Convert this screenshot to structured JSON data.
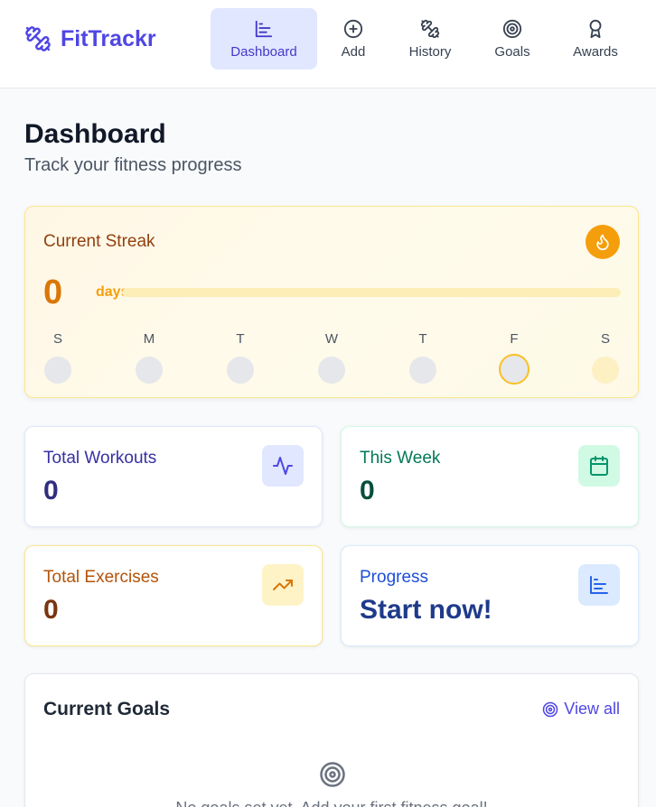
{
  "app": {
    "name": "FitTrackr",
    "accent": "#4f46e5"
  },
  "nav": {
    "items": [
      {
        "label": "Dashboard",
        "icon": "bar-chart-icon",
        "active": true
      },
      {
        "label": "Add",
        "icon": "plus-circle-icon",
        "active": false
      },
      {
        "label": "History",
        "icon": "dumbbell-icon",
        "active": false
      },
      {
        "label": "Goals",
        "icon": "target-icon",
        "active": false
      },
      {
        "label": "Awards",
        "icon": "award-icon",
        "active": false
      }
    ]
  },
  "page": {
    "title": "Dashboard",
    "subtitle": "Track your fitness progress"
  },
  "streak": {
    "title": "Current Streak",
    "count": "0",
    "unit": "days",
    "progress": 0,
    "icon": "flame-icon",
    "days": [
      {
        "label": "S",
        "state": "past"
      },
      {
        "label": "M",
        "state": "past"
      },
      {
        "label": "T",
        "state": "past"
      },
      {
        "label": "W",
        "state": "past"
      },
      {
        "label": "T",
        "state": "past"
      },
      {
        "label": "F",
        "state": "today"
      },
      {
        "label": "S",
        "state": "future"
      }
    ]
  },
  "stats": {
    "total_workouts": {
      "label": "Total Workouts",
      "value": "0",
      "icon": "activity-icon",
      "color": "#4f46e5"
    },
    "this_week": {
      "label": "This Week",
      "value": "0",
      "icon": "calendar-icon",
      "color": "#059669"
    },
    "total_exercises": {
      "label": "Total Exercises",
      "value": "0",
      "icon": "trending-up-icon",
      "color": "#d97706"
    },
    "progress": {
      "label": "Progress",
      "value": "Start now!",
      "icon": "bar-chart-icon",
      "color": "#2563eb"
    }
  },
  "goals": {
    "title": "Current Goals",
    "view_all": "View all",
    "empty_text": "No goals set yet. Add your first fitness goal!"
  }
}
